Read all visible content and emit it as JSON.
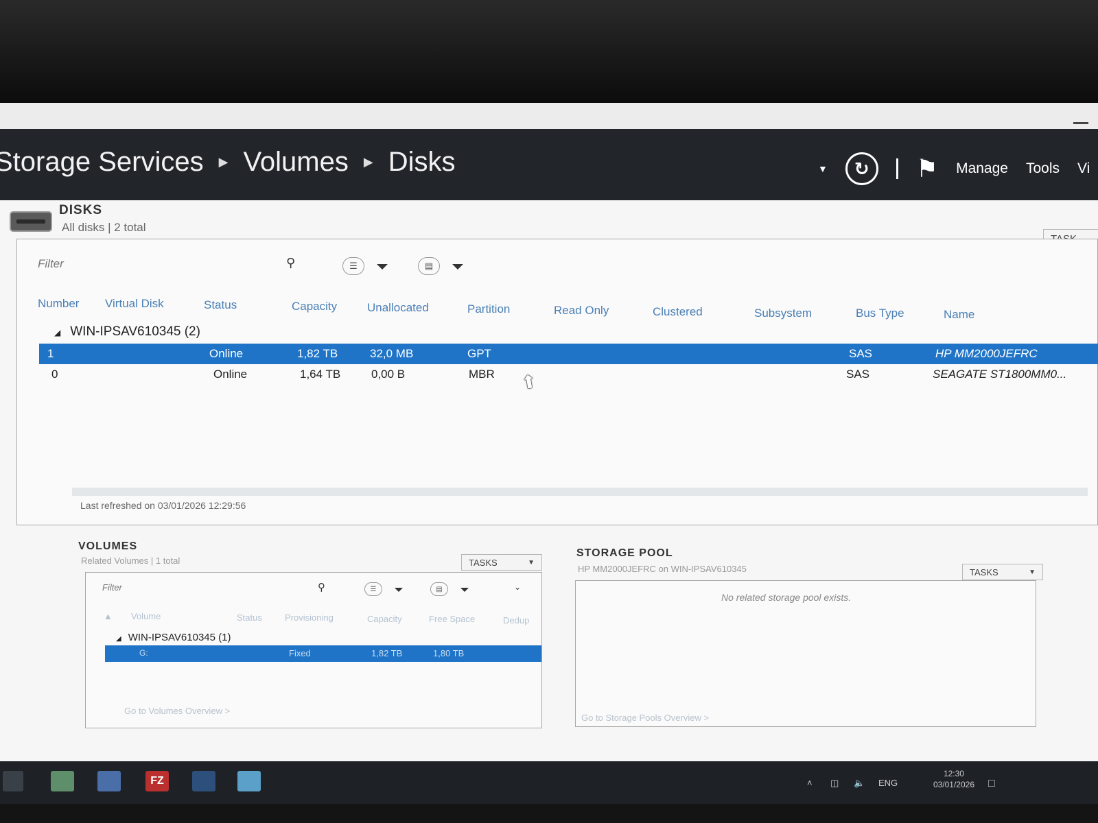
{
  "header": {
    "breadcrumbs": [
      "Storage Services",
      "Volumes",
      "Disks"
    ],
    "menu": [
      "Manage",
      "Tools",
      "Vi"
    ]
  },
  "disks": {
    "title": "DISKS",
    "subtitle": "All disks | 2 total",
    "tasks_label": "TASK",
    "filter_placeholder": "Filter",
    "columns": [
      "Number",
      "Virtual Disk",
      "Status",
      "Capacity",
      "Unallocated",
      "Partition",
      "Read Only",
      "Clustered",
      "Subsystem",
      "Bus Type",
      "Name"
    ],
    "group": "WIN-IPSAV610345 (2)",
    "rows": [
      {
        "number": "1",
        "status": "Online",
        "capacity": "1,82 TB",
        "unallocated": "32,0 MB",
        "partition": "GPT",
        "bus_type": "SAS",
        "name": "HP MM2000JEFRC"
      },
      {
        "number": "0",
        "status": "Online",
        "capacity": "1,64 TB",
        "unallocated": "0,00 B",
        "partition": "MBR",
        "bus_type": "SAS",
        "name": "SEAGATE ST1800MM0..."
      }
    ],
    "last_refreshed": "Last refreshed on 03/01/2026 12:29:56"
  },
  "volumes": {
    "title": "VOLUMES",
    "subtitle": "Related Volumes | 1 total",
    "tasks_label": "TASKS",
    "filter_placeholder": "Filter",
    "columns": [
      "Volume",
      "Status",
      "Provisioning",
      "Capacity",
      "Free Space",
      "Dedup"
    ],
    "group": "WIN-IPSAV610345 (1)",
    "rows": [
      {
        "volume": "G:",
        "provisioning": "Fixed",
        "capacity": "1,82 TB",
        "free_space": "1,80 TB"
      }
    ],
    "link": "Go to Volumes Overview >"
  },
  "storage_pool": {
    "title": "STORAGE POOL",
    "subtitle": "HP MM2000JEFRC on WIN-IPSAV610345",
    "tasks_label": "TASKS",
    "message": "No related storage pool exists.",
    "link": "Go to Storage Pools Overview >"
  },
  "taskbar": {
    "language": "ENG",
    "time": "12:30",
    "date": "03/01/2026"
  },
  "colors": {
    "header_bg": "#22262b",
    "selection": "#1f74c7",
    "column_header": "#4a7fb5"
  }
}
